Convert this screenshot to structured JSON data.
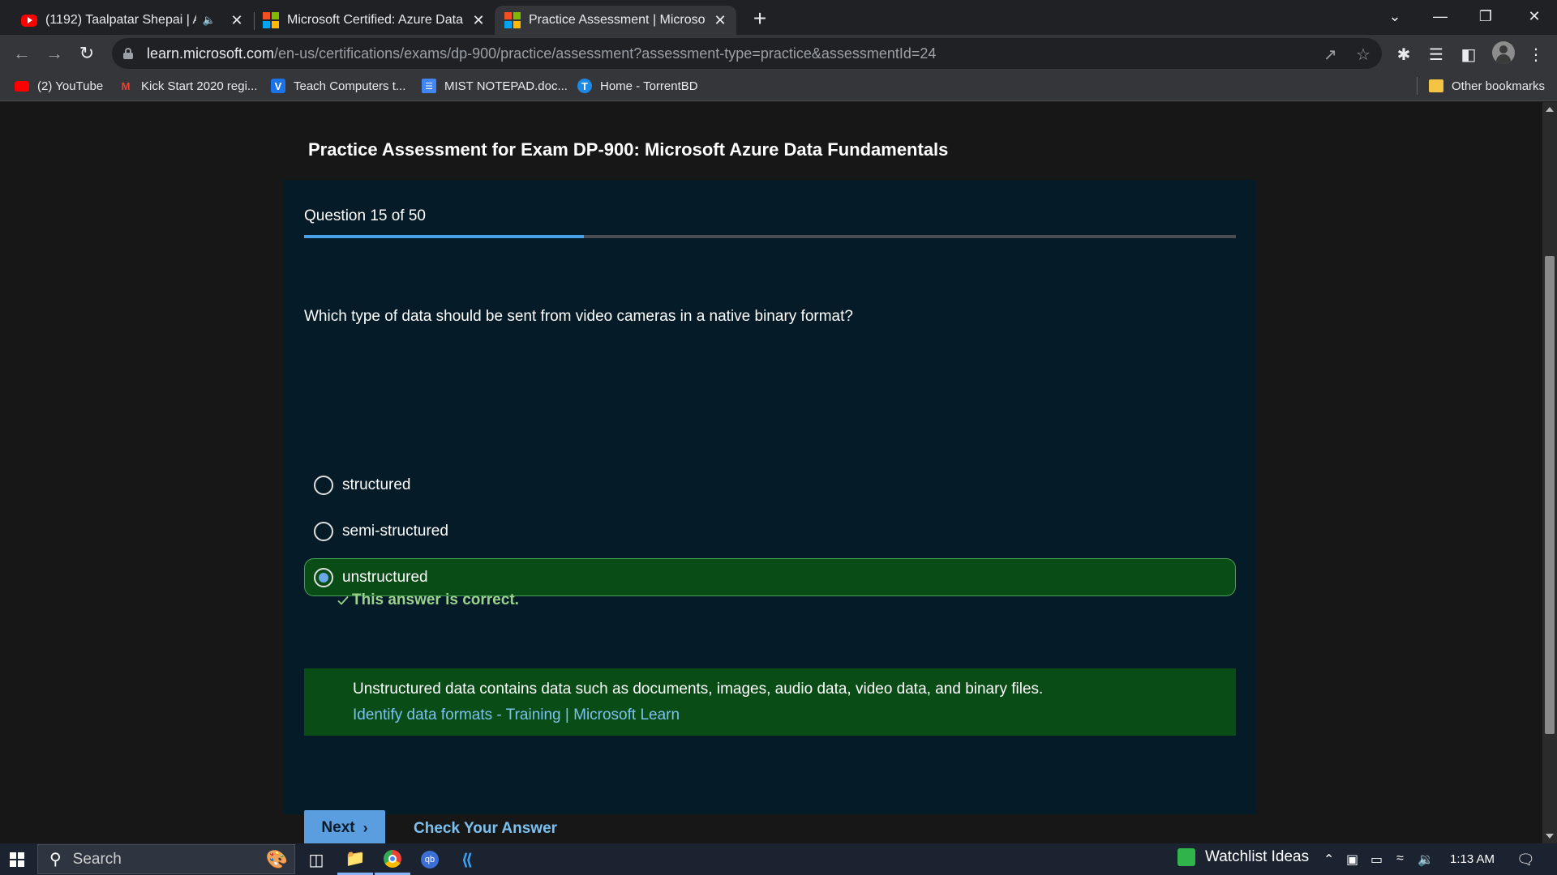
{
  "browser": {
    "tabs": [
      {
        "title": "(1192) Taalpatar Shepai | Ami",
        "favicon": "youtube-icon",
        "muted_icon": "speaker-icon",
        "active": false
      },
      {
        "title": "Microsoft Certified: Azure Data Fu",
        "favicon": "microsoft-icon",
        "active": false
      },
      {
        "title": "Practice Assessment | Microsoft L",
        "favicon": "microsoft-icon",
        "active": true
      }
    ],
    "url_host": "learn.microsoft.com",
    "url_path": "/en-us/certifications/exams/dp-900/practice/assessment?assessment-type=practice&assessmentId=24",
    "bookmarks": [
      {
        "label": "(2) YouTube",
        "icon": "youtube-icon"
      },
      {
        "label": "Kick Start 2020 regi...",
        "icon": "gmail-icon"
      },
      {
        "label": "Teach Computers t...",
        "icon": "v-icon"
      },
      {
        "label": "MIST NOTEPAD.doc...",
        "icon": "docs-icon"
      },
      {
        "label": "Home - TorrentBD",
        "icon": "torrentbd-icon"
      }
    ],
    "other_bookmarks": "Other bookmarks"
  },
  "page": {
    "title": "Practice Assessment for Exam DP-900: Microsoft Azure Data Fundamentals",
    "question_counter": "Question 15 of 50",
    "progress": {
      "current": 15,
      "total": 50
    },
    "question": "Which type of data should be sent from video cameras in a native binary format?",
    "options": [
      {
        "label": "structured",
        "selected": false
      },
      {
        "label": "semi-structured",
        "selected": false
      },
      {
        "label": "unstructured",
        "selected": true
      }
    ],
    "feedback": "This answer is correct.",
    "explanation": "Unstructured data contains data such as documents, images, audio data, video data, and binary files.",
    "explanation_link": "Identify data formats - Training | Microsoft Learn",
    "next_label": "Next",
    "check_label": "Check Your Answer"
  },
  "taskbar": {
    "search_placeholder": "Search",
    "watchlist": "Watchlist Ideas",
    "time": "1:13 AM"
  },
  "colors": {
    "card_bg": "#051b27",
    "correct_green": "#0a4c16",
    "accent_blue": "#5a9ee0",
    "link_blue": "#7cc0f0",
    "correct_text": "#9ad48a"
  }
}
